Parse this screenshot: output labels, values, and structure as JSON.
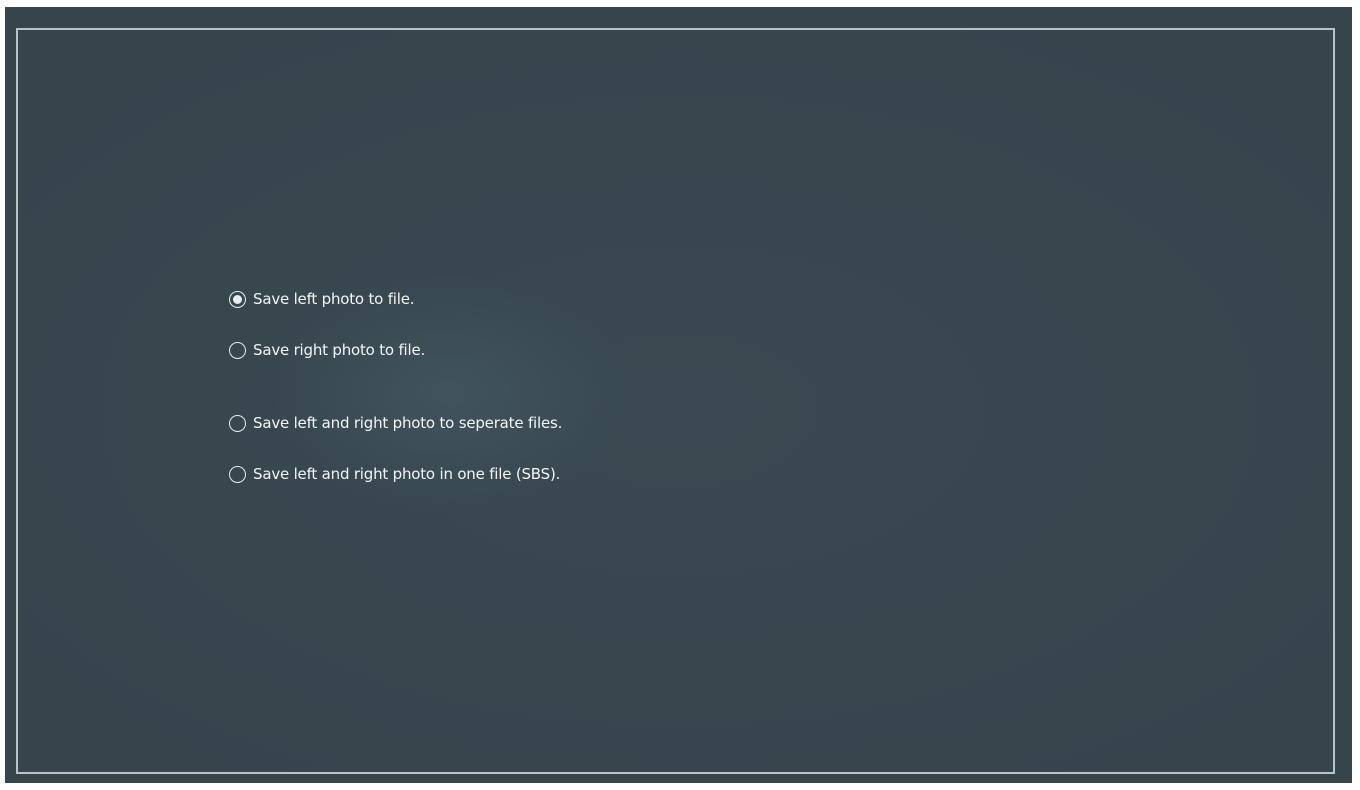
{
  "save_options": {
    "items": [
      {
        "label": "Save left photo to file.",
        "checked": true
      },
      {
        "label": "Save right photo to file.",
        "checked": false
      },
      {
        "label": "Save left and right photo to seperate files.",
        "checked": false
      },
      {
        "label": "Save left and right photo in one file (SBS).",
        "checked": false
      }
    ]
  },
  "colors": {
    "background": "#36444c",
    "frame_border": "#b9c3c7",
    "text": "#f2f5f6"
  }
}
